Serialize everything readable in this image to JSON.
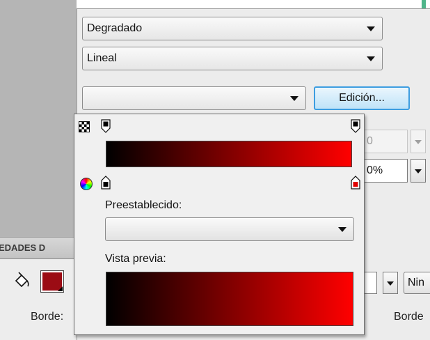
{
  "background": {
    "props_tab_label": "EDADES D",
    "stroke_label_left": "Borde:",
    "stroke_label_right": "Borde",
    "stroke_color": "#9b0c14",
    "disabled_value": "0",
    "percent_value": "0%",
    "blank_value": "",
    "style_value": "Nin"
  },
  "color_panel": {
    "fill_type": "Degradado",
    "flow_type": "Lineal",
    "third_combo_value": "",
    "edit_button_label": "Edición...",
    "accent_color": "#4fb58a"
  },
  "gradient_editor": {
    "preset_label": "Preestablecido:",
    "preset_value": "",
    "preview_label": "Vista previa:",
    "stop_start_color": "#000000",
    "stop_end_color": "#ff0000",
    "icons": [
      "alpha-checker-icon",
      "color-wheel-icon",
      "paint-bucket-icon"
    ]
  }
}
